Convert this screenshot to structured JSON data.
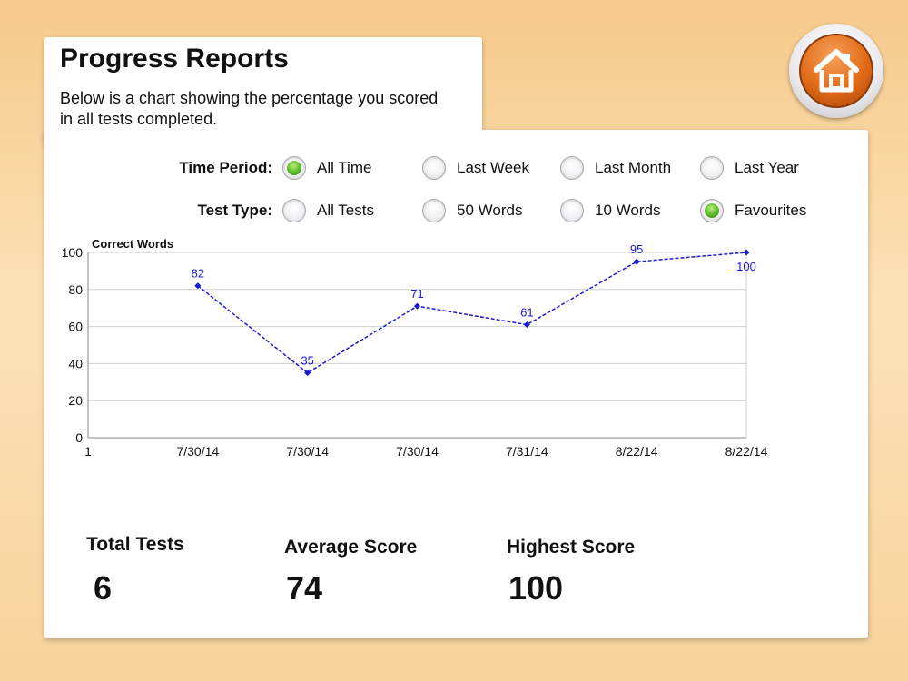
{
  "header": {
    "title": "Progress Reports",
    "subtitle": "Below is a chart showing the percentage you scored in all tests completed."
  },
  "filters": {
    "time_period": {
      "label": "Time Period:",
      "options": [
        "All Time",
        "Last Week",
        "Last Month",
        "Last Year"
      ],
      "selected": "All Time"
    },
    "test_type": {
      "label": "Test Type:",
      "options": [
        "All Tests",
        "50 Words",
        "10 Words",
        "Favourites"
      ],
      "selected": "Favourites"
    }
  },
  "home_button": {
    "icon": "home-icon"
  },
  "chart_data": {
    "type": "line",
    "ylabel": "Correct Words",
    "ylim": [
      0,
      100
    ],
    "yticks": [
      0,
      20,
      40,
      60,
      80,
      100
    ],
    "x_origin_label": "1",
    "categories": [
      "7/30/14",
      "7/30/14",
      "7/30/14",
      "7/31/14",
      "8/22/14",
      "8/22/14"
    ],
    "series": [
      {
        "values": [
          82,
          35,
          71,
          61,
          95,
          100
        ],
        "color": "#1a1ad6"
      }
    ],
    "grid": true
  },
  "stats": {
    "total_tests": {
      "label": "Total Tests",
      "value": "6"
    },
    "average_score": {
      "label": "Average Score",
      "value": "74"
    },
    "highest_score": {
      "label": "Highest Score",
      "value": "100"
    }
  }
}
